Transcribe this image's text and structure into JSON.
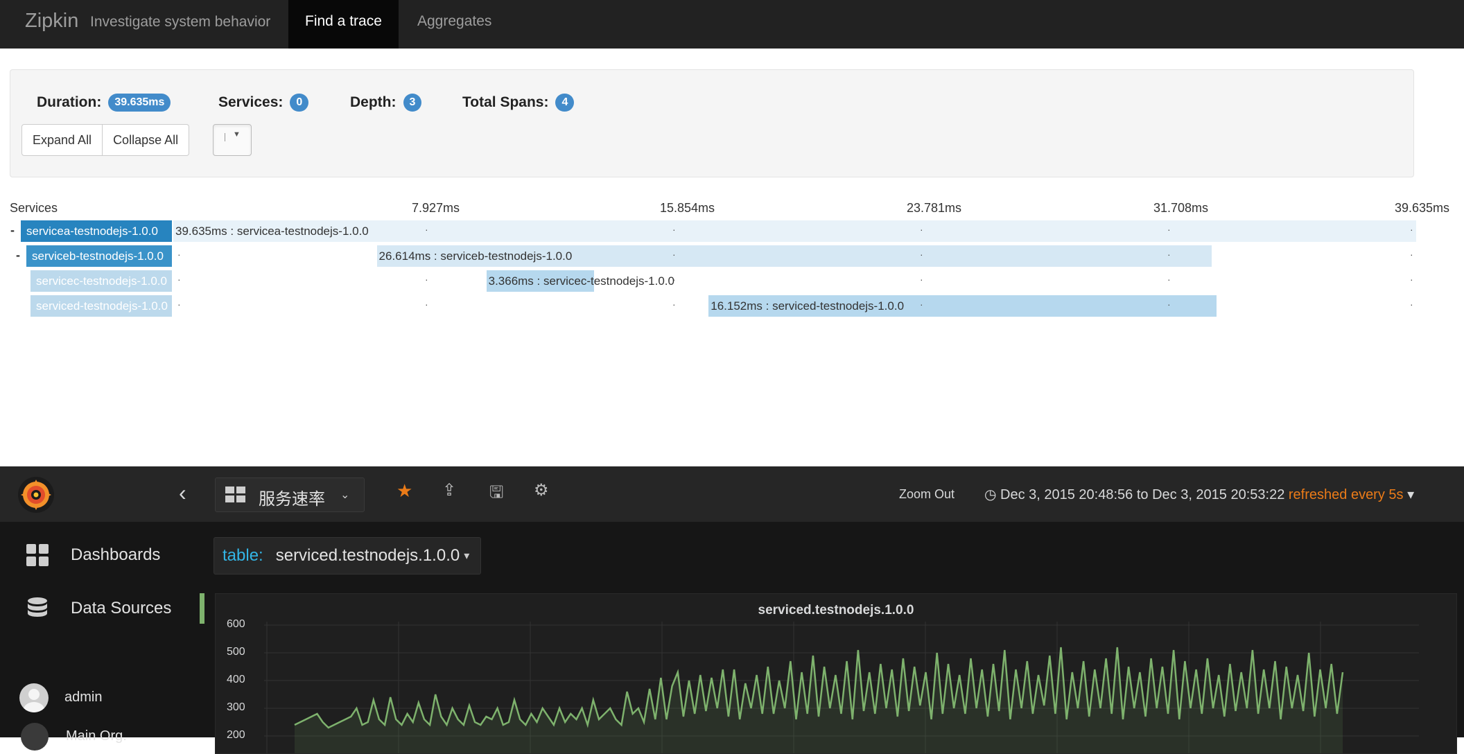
{
  "zipkin": {
    "brand": "Zipkin",
    "tagline": "Investigate system behavior",
    "tabs": [
      {
        "label": "Find a trace",
        "active": true
      },
      {
        "label": "Aggregates",
        "active": false
      }
    ],
    "summary": {
      "duration_label": "Duration:",
      "duration": "39.635ms",
      "services_label": "Services:",
      "services": "0",
      "depth_label": "Depth:",
      "depth": "3",
      "spans_label": "Total Spans:",
      "spans": "4"
    },
    "buttons": {
      "expand_all": "Expand All",
      "collapse_all": "Collapse All"
    },
    "timeline": {
      "services_header": "Services",
      "ticks": [
        "7.927ms",
        "15.854ms",
        "23.781ms",
        "31.708ms",
        "39.635ms"
      ]
    },
    "spans": [
      {
        "service": "servicea-testnodejs-1.0.0",
        "toggle": "-",
        "label": "39.635ms : servicea-testnodejs-1.0.0",
        "start_ms": 0,
        "duration_ms": 39.635
      },
      {
        "service": "serviceb-testnodejs-1.0.0",
        "toggle": "-",
        "label": "26.614ms : serviceb-testnodejs-1.0.0",
        "start_ms": 6.5,
        "duration_ms": 26.614
      },
      {
        "service": "servicec-testnodejs-1.0.0",
        "toggle": "",
        "label": "3.366ms : servicec-testnodejs-1.0.0",
        "start_ms": 10.0,
        "duration_ms": 3.366
      },
      {
        "service": "serviced-testnodejs-1.0.0",
        "toggle": "",
        "label": "16.152ms : serviced-testnodejs-1.0.0",
        "start_ms": 17.1,
        "duration_ms": 16.152
      }
    ],
    "colors": {
      "depth0": "#2784bf",
      "depth1": "#3a93c9",
      "depth2": "#bcd9ec",
      "span0": "#e8f2f9",
      "span1": "#d6e8f4",
      "span2": "#b6d8ee"
    }
  },
  "grafana": {
    "dashboard_title": "服务速率",
    "zoom_out": "Zoom Out",
    "time_range": "Dec 3, 2015 20:48:56 to Dec 3, 2015 20:53:22",
    "refresh": "refreshed every 5s",
    "sidebar": {
      "items": [
        {
          "label": "Dashboards"
        },
        {
          "label": "Data Sources"
        }
      ],
      "user": "admin",
      "org": "Main Org."
    },
    "template_var": {
      "label": "table:",
      "value": "serviced.testnodejs.1.0.0"
    },
    "accent_colors": {
      "star": "#eb7b18",
      "series": "#7eb26d",
      "var_label": "#33b5e5"
    }
  },
  "chart_data": {
    "type": "line",
    "title": "serviced.testnodejs.1.0.0",
    "ylim": [
      200,
      600
    ],
    "yticks": [
      600,
      500,
      400,
      300,
      200
    ],
    "series": [
      {
        "values": [
          240,
          250,
          260,
          270,
          280,
          250,
          230,
          240,
          250,
          260,
          270,
          300,
          240,
          250,
          330,
          260,
          240,
          340,
          260,
          240,
          280,
          250,
          320,
          260,
          240,
          350,
          270,
          240,
          300,
          260,
          240,
          310,
          250,
          240,
          270,
          260,
          300,
          240,
          250,
          330,
          260,
          240,
          280,
          250,
          300,
          270,
          240,
          300,
          250,
          280,
          260,
          300,
          240,
          330,
          260,
          280,
          300,
          260,
          240,
          360,
          280,
          300,
          250,
          370,
          260,
          410,
          260,
          380,
          430,
          270,
          400,
          280,
          420,
          290,
          410,
          300,
          440,
          270,
          440,
          260,
          390,
          300,
          420,
          280,
          450,
          280,
          400,
          300,
          470,
          260,
          430,
          280,
          490,
          270,
          450,
          300,
          420,
          280,
          470,
          260,
          510,
          290,
          430,
          280,
          460,
          300,
          440,
          270,
          480,
          290,
          450,
          310,
          430,
          260,
          500,
          280,
          460,
          300,
          420,
          280,
          480,
          300,
          440,
          270,
          460,
          290,
          510,
          260,
          440,
          300,
          470,
          280,
          420,
          310,
          490,
          280,
          520,
          260,
          430,
          300,
          470,
          270,
          440,
          300,
          480,
          280,
          520,
          260,
          450,
          300,
          430,
          270,
          480,
          300,
          450,
          280,
          510,
          260,
          470,
          300,
          440,
          280,
          480,
          300,
          420,
          270,
          460,
          290,
          430,
          300,
          510,
          280,
          440,
          300,
          470,
          260,
          450,
          300,
          420,
          290,
          500,
          270,
          440,
          300,
          460,
          280,
          430
        ]
      }
    ]
  }
}
